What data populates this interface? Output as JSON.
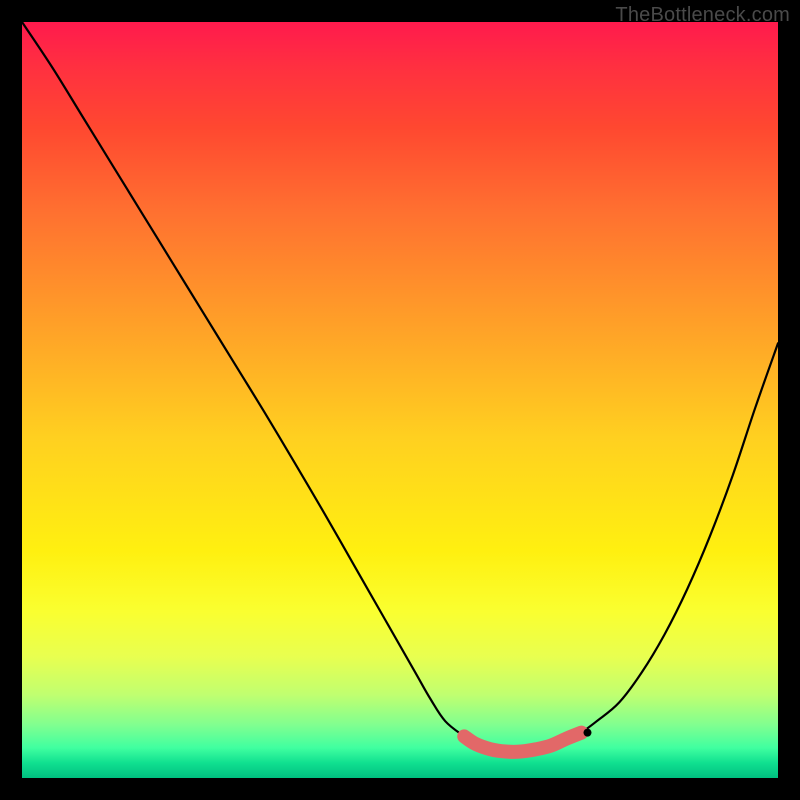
{
  "watermark": "TheBottleneck.com",
  "chart_data": {
    "type": "line",
    "title": "",
    "xlabel": "",
    "ylabel": "",
    "xlim": [
      0,
      100
    ],
    "ylim": [
      0,
      100
    ],
    "series": [
      {
        "name": "left-curve",
        "x": [
          0,
          4,
          8,
          12,
          16,
          20,
          24,
          28,
          32,
          36,
          40,
          44,
          48,
          52,
          54,
          56,
          58.5
        ],
        "values": [
          100,
          94,
          87.5,
          81,
          74.5,
          68,
          61.5,
          55,
          48.5,
          41.8,
          35,
          28,
          21,
          14,
          10.5,
          7.5,
          5.5
        ]
      },
      {
        "name": "right-curve",
        "x": [
          74,
          76,
          79,
          82,
          85,
          88,
          91,
          94,
          97,
          100
        ],
        "values": [
          6,
          7.5,
          10,
          14,
          19,
          25,
          32,
          40,
          49,
          57.5
        ]
      },
      {
        "name": "valley-highlight",
        "x": [
          58.5,
          60,
          62,
          64,
          66,
          68,
          70,
          72,
          74
        ],
        "values": [
          5.5,
          4.5,
          3.8,
          3.5,
          3.5,
          3.8,
          4.3,
          5.2,
          6
        ],
        "color": "#e26868",
        "stroke_width": 9
      }
    ],
    "points": [
      {
        "name": "right-dot",
        "x": 74.8,
        "y": 6,
        "color": "#000000",
        "r": 3
      }
    ]
  }
}
